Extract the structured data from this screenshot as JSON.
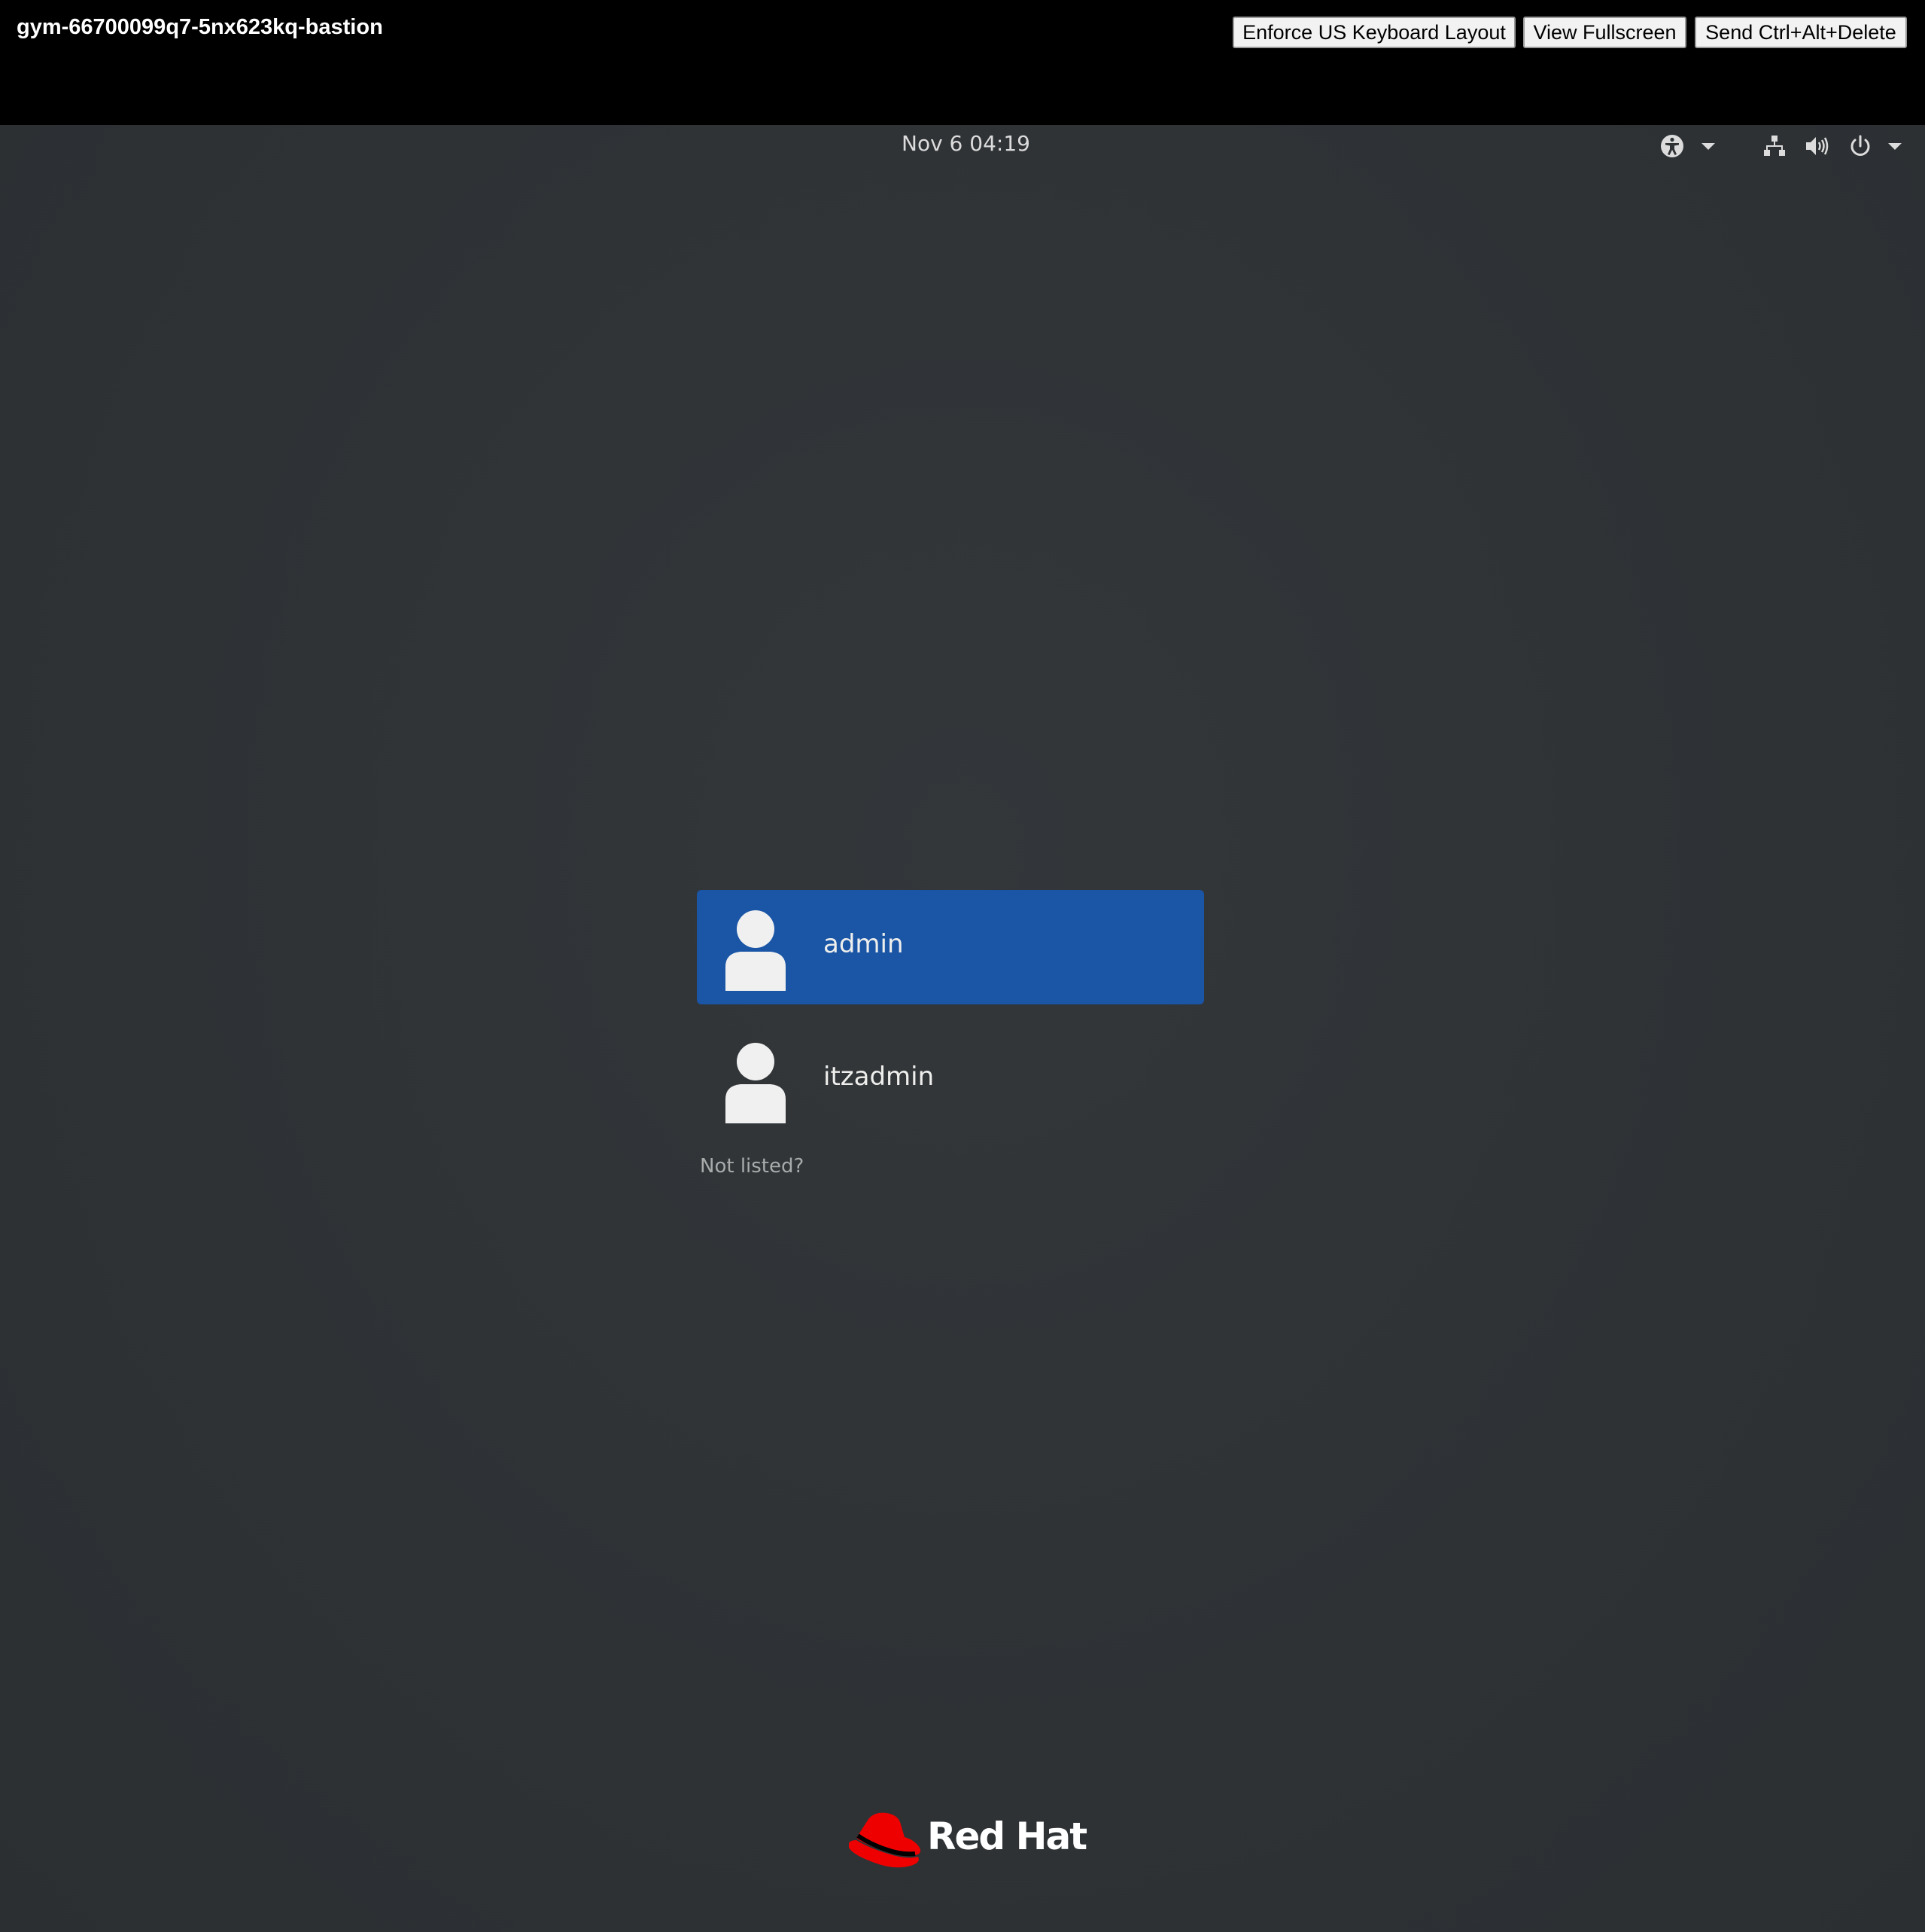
{
  "console": {
    "title": "gym-66700099q7-5nx623kq-bastion",
    "buttons": {
      "enforce_keyboard": "Enforce US Keyboard Layout",
      "view_fullscreen": "View Fullscreen",
      "send_ctrl_alt_delete": "Send Ctrl+Alt+Delete"
    }
  },
  "panel": {
    "clock": "Nov 6  04:19",
    "icons": [
      "accessibility-icon",
      "chevron-down-icon",
      "network-icon",
      "volume-icon",
      "power-icon",
      "chevron-down-icon"
    ]
  },
  "login": {
    "users": [
      {
        "name": "admin",
        "selected": true
      },
      {
        "name": "itzadmin",
        "selected": false
      }
    ],
    "not_listed": "Not listed?"
  },
  "branding": {
    "logo_text": "Red Hat",
    "logo_color": "#ee0000"
  },
  "colors": {
    "desktop_bg": "#2e3235",
    "selected_row": "#1a55a6"
  }
}
